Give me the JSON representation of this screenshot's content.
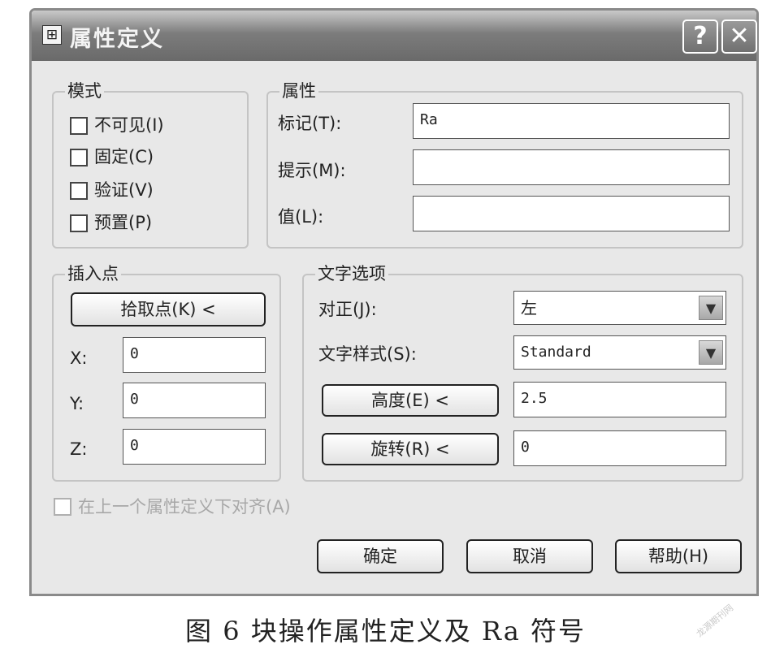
{
  "window": {
    "title": "属性定义"
  },
  "titlebar": {
    "help_label": "?",
    "close_label": "✕"
  },
  "mode": {
    "legend": "模式",
    "items": [
      {
        "label": "不可见",
        "hotkey": "(I)",
        "checked": false
      },
      {
        "label": "固定",
        "hotkey": "(C)",
        "checked": false
      },
      {
        "label": "验证",
        "hotkey": "(V)",
        "checked": false
      },
      {
        "label": "预置",
        "hotkey": "(P)",
        "checked": false
      }
    ]
  },
  "attribute": {
    "legend": "属性",
    "tag": {
      "label": "标记(T):",
      "value": "Ra"
    },
    "prompt": {
      "label": "提示(M):",
      "value": ""
    },
    "default": {
      "label": "值(L):",
      "value": ""
    }
  },
  "insertion_point": {
    "legend": "插入点",
    "pick_button": "拾取点(K) <",
    "x": {
      "label": "X:",
      "value": "0"
    },
    "y": {
      "label": "Y:",
      "value": "0"
    },
    "z": {
      "label": "Z:",
      "value": "0"
    }
  },
  "text_options": {
    "legend": "文字选项",
    "justification": {
      "label": "对正(J):",
      "value": "左"
    },
    "text_style": {
      "label": "文字样式(S):",
      "value": "Standard"
    },
    "height": {
      "button": "高度(E) <",
      "value": "2.5"
    },
    "rotation": {
      "button": "旋转(R) <",
      "value": "0"
    }
  },
  "align_below": {
    "label": "在上一个属性定义下对齐(A)",
    "checked": false,
    "enabled": false
  },
  "footer": {
    "ok": "确定",
    "cancel": "取消",
    "help": "帮助(H)"
  },
  "caption": "图 6  块操作属性定义及 Ra 符号",
  "watermark": "龙源期刊网"
}
